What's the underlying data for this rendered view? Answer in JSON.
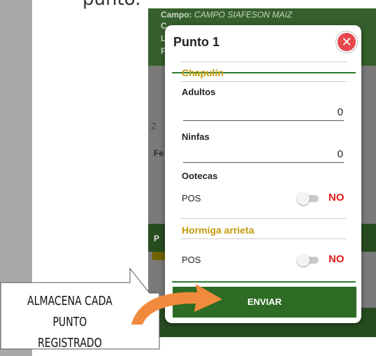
{
  "intro": {
    "text": "punto."
  },
  "background_app": {
    "campo_label": "Campo:",
    "campo_value": "CAMPO SIAFESON MAIZ",
    "partial_letters": [
      "C",
      "L",
      "F"
    ],
    "row_number": "2",
    "fe_fragment": "Fe",
    "p_fragment": "P"
  },
  "dialog": {
    "title": "Punto 1",
    "close_icon": "close-icon",
    "sections": [
      {
        "title": "Chapulín",
        "fields": [
          {
            "label": "Adultos",
            "value": "0"
          },
          {
            "label": "Ninfas",
            "value": "0"
          },
          {
            "label": "Ootecas",
            "pos_label": "POS",
            "toggle_state": "NO"
          }
        ]
      },
      {
        "title": "Hormiga arrieta",
        "fields": [
          {
            "pos_label": "POS",
            "toggle_state": "NO"
          }
        ]
      }
    ],
    "submit_label": "ENVIAR"
  },
  "callout": {
    "line1": "ALMACENA CADA PUNTO",
    "line2": "REGISTRADO",
    "arrow_icon": "curved-arrow-icon",
    "arrow_color": "#f08a3c"
  },
  "colors": {
    "header_green": "#355f2c",
    "accent_gold": "#c49a0c",
    "no_red": "#e21b1b",
    "close_red": "#e5484d",
    "button_green": "#2e6b24"
  }
}
